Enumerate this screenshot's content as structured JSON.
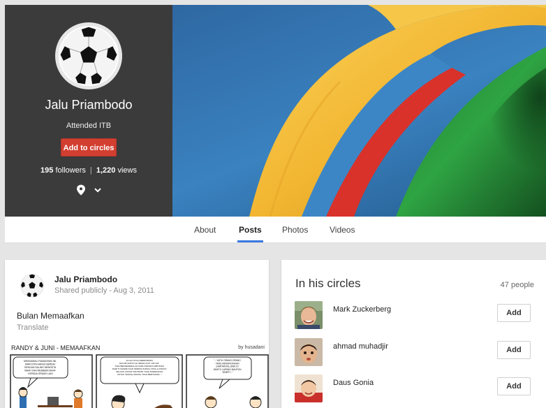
{
  "profile": {
    "name": "Jalu Priambodo",
    "education": "Attended ITB",
    "add_button": "Add to circles",
    "followers": "195",
    "followers_label": "followers",
    "views": "1,220",
    "views_label": "views",
    "separator": "|",
    "icons": {
      "location": "map-pin-icon",
      "menu": "chevron-down-icon",
      "avatar": "soccer-ball"
    }
  },
  "tabs": [
    {
      "label": "About",
      "active": false
    },
    {
      "label": "Posts",
      "active": true
    },
    {
      "label": "Photos",
      "active": false
    },
    {
      "label": "Videos",
      "active": false
    }
  ],
  "post": {
    "author": "Jalu Priambodo",
    "visibility": "Shared publicly",
    "dot": "-",
    "date": "Aug 3, 2011",
    "text": "Bulan Memaafkan",
    "translate": "Translate",
    "comic": {
      "title": "RANDY & JUNI  -  MEMAAFKAN",
      "credit": "by husadani",
      "bubbles": [
        "MENGAWALI RAMADHAN INI, MARI KITA HARUS BERSIH DENGAN SALING MENGETA MAAF DAN MEMBERI MAAF KEPADA ORANG LAIN",
        "ALLAH TA'ALA BERFIRMAN DALAM SURAT ALI IMRAN AYAT 133-134: \"DAN BERSEGERALAH KAMU KEPADA AMPUNAN DARI TUHANMU DAN KEPADA SURGA YANG LUASNYA SELUAS LANGIT DAN BUMI YANG DISEDIAKAN UNTUK ORANG-ORANG YANG BERTAKWA...\"",
        "\"...YAITU ORANG-ORANG YANG MENAFKAHKAN (HARTANYA), BAIK DI WAKTU LAPANG MAUPUN SEMPIT...\""
      ]
    }
  },
  "circles": {
    "title": "In his circles",
    "count": "47 people",
    "people": [
      {
        "name": "Mark Zuckerberg",
        "action": "Add"
      },
      {
        "name": "ahmad muhadjir",
        "action": "Add"
      },
      {
        "name": "Daus Gonia",
        "action": "Add"
      }
    ]
  },
  "colors": {
    "accent_red": "#d23f31",
    "tab_underline": "#3a78e0",
    "panel_dark": "#3b3b3b",
    "cover_blue": "#2f6ea8",
    "cover_yellow": "#f2b632",
    "cover_red": "#d8322b",
    "cover_green": "#2a9a3c"
  }
}
